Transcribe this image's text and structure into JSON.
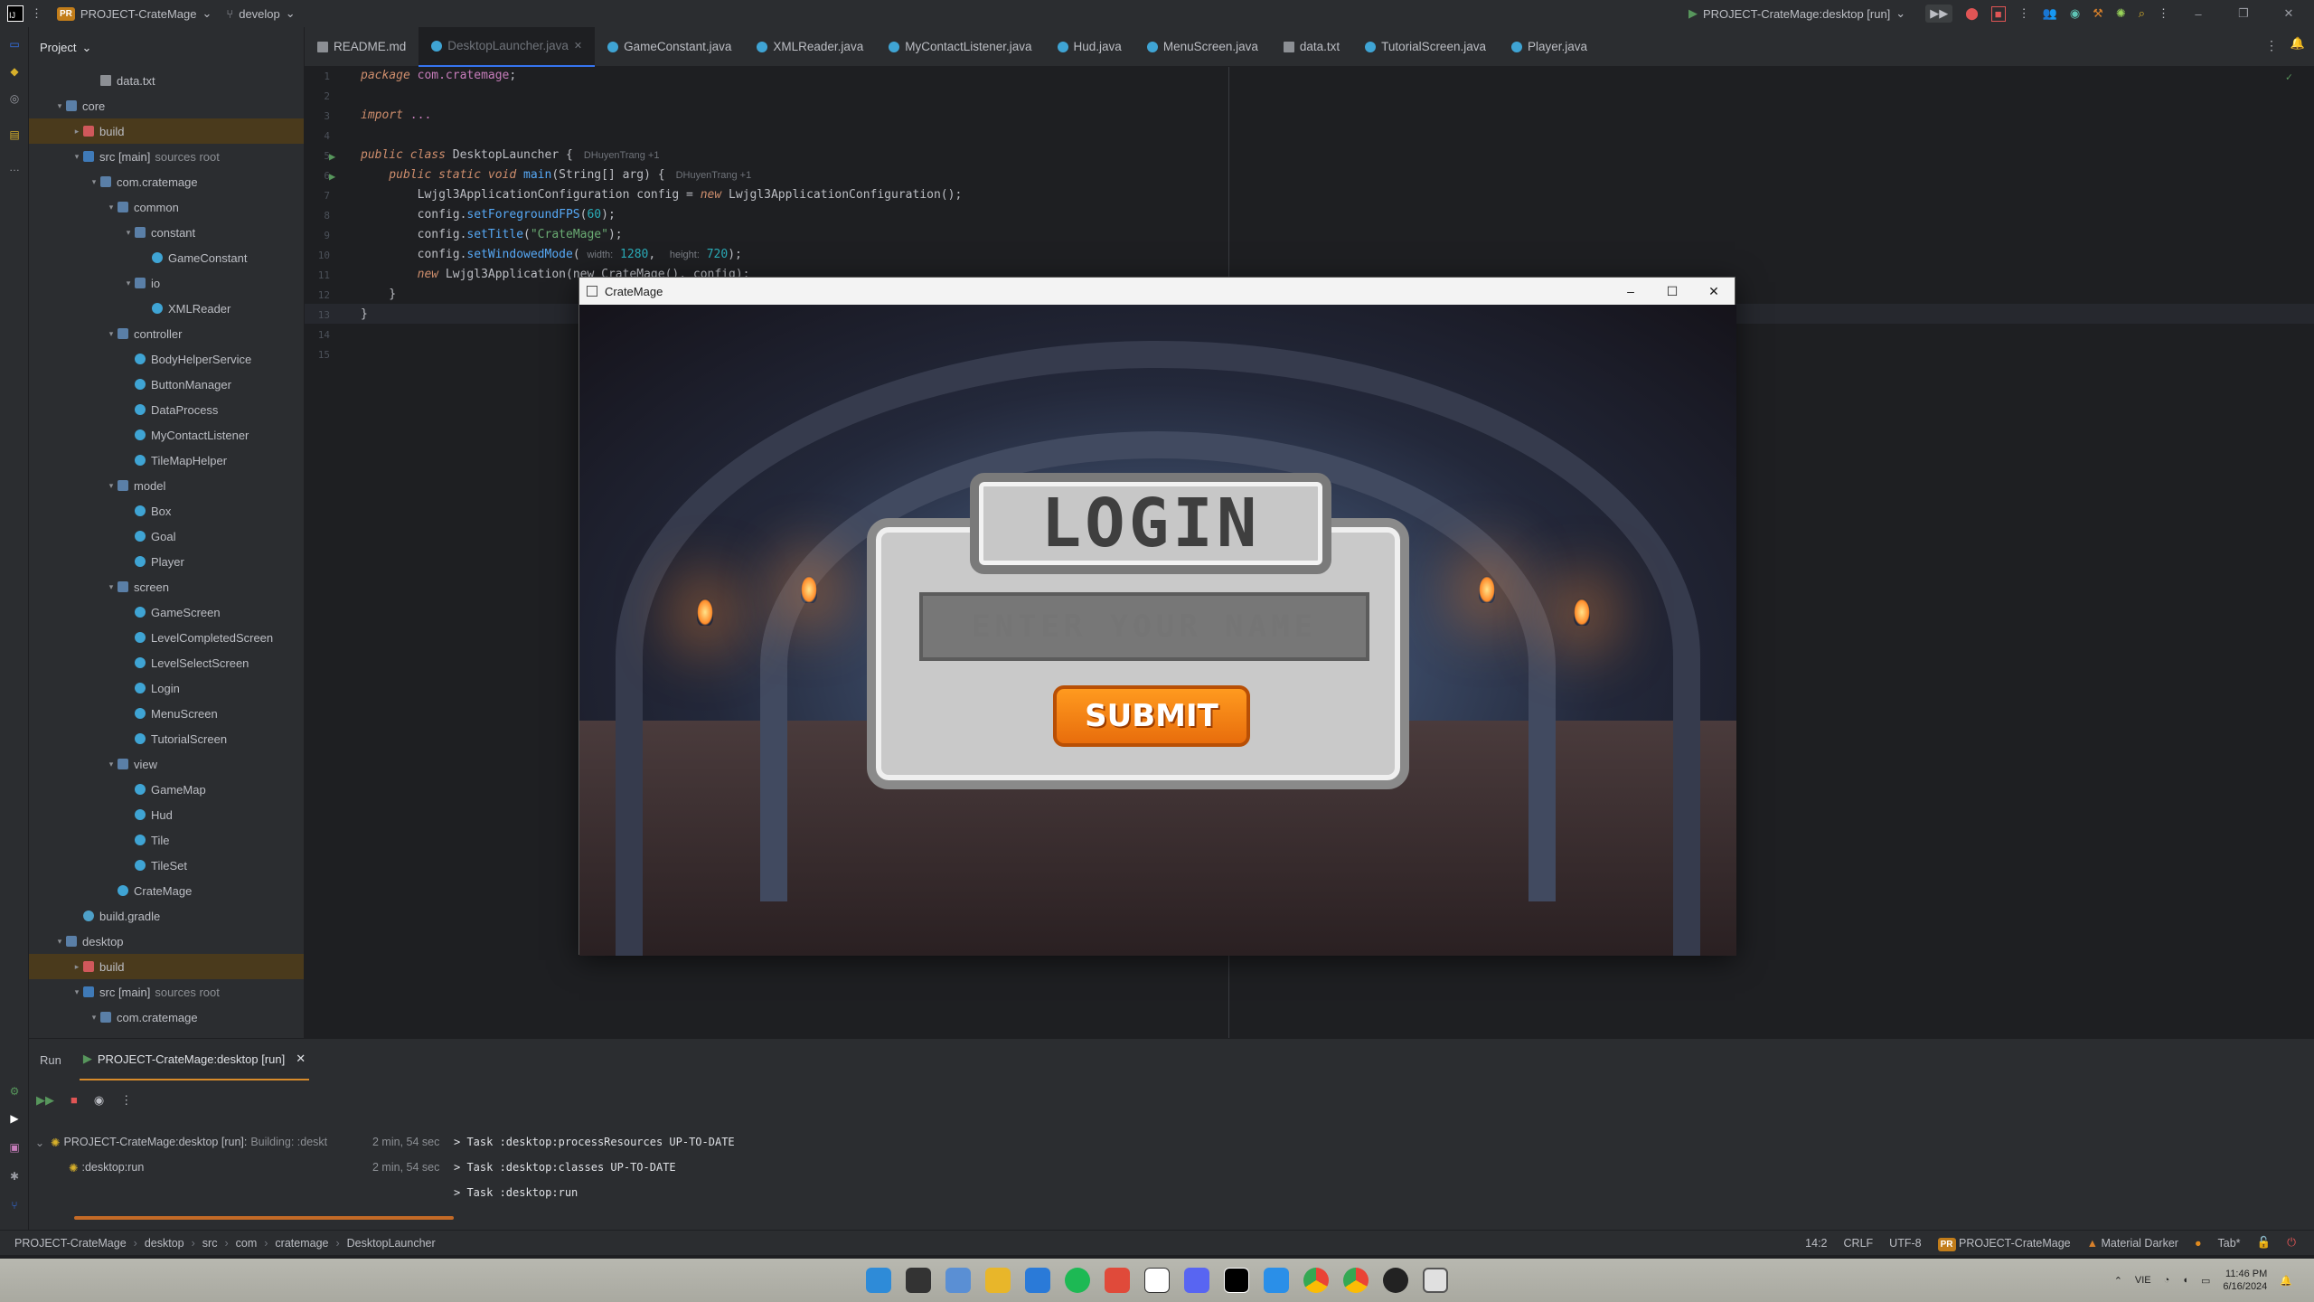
{
  "titlebar": {
    "project_badge": "PR",
    "project_name": "PROJECT-CrateMage",
    "branch": "develop",
    "run_config": "PROJECT-CrateMage:desktop [run]"
  },
  "project_panel": {
    "title": "Project",
    "rows": [
      {
        "label": "data.txt",
        "icon": "file",
        "indent": 3,
        "arrow": ""
      },
      {
        "label": "core",
        "icon": "folder",
        "indent": 1,
        "arrow": "v"
      },
      {
        "label": "build",
        "icon": "folder-red",
        "indent": 2,
        "arrow": ">",
        "selected": true
      },
      {
        "label": "src [main]",
        "suffix": "sources root",
        "icon": "folder-src",
        "indent": 2,
        "arrow": "v"
      },
      {
        "label": "com.cratemage",
        "icon": "pkg",
        "indent": 3,
        "arrow": "v"
      },
      {
        "label": "common",
        "icon": "pkg",
        "indent": 4,
        "arrow": "v"
      },
      {
        "label": "constant",
        "icon": "pkg",
        "indent": 5,
        "arrow": "v"
      },
      {
        "label": "GameConstant",
        "icon": "java",
        "indent": 6,
        "arrow": ""
      },
      {
        "label": "io",
        "icon": "pkg",
        "indent": 5,
        "arrow": "v"
      },
      {
        "label": "XMLReader",
        "icon": "java",
        "indent": 6,
        "arrow": ""
      },
      {
        "label": "controller",
        "icon": "pkg",
        "indent": 4,
        "arrow": "v"
      },
      {
        "label": "BodyHelperService",
        "icon": "java",
        "indent": 5,
        "arrow": ""
      },
      {
        "label": "ButtonManager",
        "icon": "java",
        "indent": 5,
        "arrow": ""
      },
      {
        "label": "DataProcess",
        "icon": "java",
        "indent": 5,
        "arrow": ""
      },
      {
        "label": "MyContactListener",
        "icon": "java",
        "indent": 5,
        "arrow": ""
      },
      {
        "label": "TileMapHelper",
        "icon": "java",
        "indent": 5,
        "arrow": ""
      },
      {
        "label": "model",
        "icon": "pkg",
        "indent": 4,
        "arrow": "v"
      },
      {
        "label": "Box",
        "icon": "java",
        "indent": 5,
        "arrow": ""
      },
      {
        "label": "Goal",
        "icon": "java",
        "indent": 5,
        "arrow": ""
      },
      {
        "label": "Player",
        "icon": "java",
        "indent": 5,
        "arrow": ""
      },
      {
        "label": "screen",
        "icon": "pkg",
        "indent": 4,
        "arrow": "v"
      },
      {
        "label": "GameScreen",
        "icon": "java",
        "indent": 5,
        "arrow": ""
      },
      {
        "label": "LevelCompletedScreen",
        "icon": "java",
        "indent": 5,
        "arrow": ""
      },
      {
        "label": "LevelSelectScreen",
        "icon": "java",
        "indent": 5,
        "arrow": ""
      },
      {
        "label": "Login",
        "icon": "java",
        "indent": 5,
        "arrow": ""
      },
      {
        "label": "MenuScreen",
        "icon": "java",
        "indent": 5,
        "arrow": ""
      },
      {
        "label": "TutorialScreen",
        "icon": "java",
        "indent": 5,
        "arrow": ""
      },
      {
        "label": "view",
        "icon": "pkg",
        "indent": 4,
        "arrow": "v"
      },
      {
        "label": "GameMap",
        "icon": "java",
        "indent": 5,
        "arrow": ""
      },
      {
        "label": "Hud",
        "icon": "java",
        "indent": 5,
        "arrow": ""
      },
      {
        "label": "Tile",
        "icon": "java",
        "indent": 5,
        "arrow": ""
      },
      {
        "label": "TileSet",
        "icon": "java",
        "indent": 5,
        "arrow": ""
      },
      {
        "label": "CrateMage",
        "icon": "java",
        "indent": 4,
        "arrow": ""
      },
      {
        "label": "build.gradle",
        "icon": "gradle",
        "indent": 2,
        "arrow": ""
      },
      {
        "label": "desktop",
        "icon": "folder",
        "indent": 1,
        "arrow": "v"
      },
      {
        "label": "build",
        "icon": "folder-red",
        "indent": 2,
        "arrow": ">",
        "selected": true
      },
      {
        "label": "src [main]",
        "suffix": "sources root",
        "icon": "folder-src",
        "indent": 2,
        "arrow": "v"
      },
      {
        "label": "com.cratemage",
        "icon": "pkg",
        "indent": 3,
        "arrow": "v"
      }
    ]
  },
  "editor_tabs": [
    {
      "label": "README.md",
      "icon": "file"
    },
    {
      "label": "DesktopLauncher.java",
      "icon": "java",
      "active": true
    },
    {
      "label": "GameConstant.java",
      "icon": "java"
    },
    {
      "label": "XMLReader.java",
      "icon": "java"
    },
    {
      "label": "MyContactListener.java",
      "icon": "java"
    },
    {
      "label": "Hud.java",
      "icon": "java"
    },
    {
      "label": "MenuScreen.java",
      "icon": "java"
    },
    {
      "label": "data.txt",
      "icon": "file"
    },
    {
      "label": "TutorialScreen.java",
      "icon": "java"
    },
    {
      "label": "Player.java",
      "icon": "java"
    }
  ],
  "editor": {
    "line_numbers": [
      "1",
      "2",
      "3",
      "4",
      "5",
      "6",
      "7",
      "8",
      "9",
      "10",
      "11",
      "12",
      "13",
      "14",
      "15"
    ],
    "author_hint": "DHuyenTrang +1",
    "code": {
      "l1_kw": "package",
      "l1_pkg": "com.cratemage",
      "l1_end": ";",
      "l3_kw": "import",
      "l3_rest": " ...",
      "l6_a": "public class",
      "l6_b": " DesktopLauncher {",
      "l7_a": "    public static void",
      "l7_b": " main",
      "l7_c": "(String[] arg) {",
      "l8_a": "        Lwjgl3ApplicationConfiguration config = ",
      "l8_b": "new",
      "l8_c": " Lwjgl3ApplicationConfiguration();",
      "l9_a": "        config.",
      "l9_b": "setForegroundFPS",
      "l9_c": "(",
      "l9_d": "60",
      "l9_e": ");",
      "l10_a": "        config.",
      "l10_b": "setTitle",
      "l10_c": "(",
      "l10_d": "\"CrateMage\"",
      "l10_e": ");",
      "l11_a": "        config.",
      "l11_b": "setWindowedMode",
      "l11_c": "( ",
      "l11_h1": "width:",
      "l11_d": " 1280",
      "l11_e": ",  ",
      "l11_h2": "height:",
      "l11_f": " 720",
      "l11_g": ");",
      "l12_a": "        ",
      "l12_b": "new",
      "l12_c": " Lwjgl3Application(new CrateMage(), config);",
      "l13": "    }",
      "l14": "}"
    }
  },
  "game_window": {
    "title": "CrateMage",
    "login_title": "LOGIN",
    "name_placeholder": "ENTER YOUR NAME",
    "submit_label": "SUBMIT"
  },
  "run_panel": {
    "tab_run": "Run",
    "tab_config": "PROJECT-CrateMage:desktop [run]",
    "tree": [
      {
        "label": "PROJECT-CrateMage:desktop [run]:",
        "detail": "Building: :deskt",
        "time": "2 min, 54 sec"
      },
      {
        "label": ":desktop:run",
        "detail": "",
        "time": "2 min, 54 sec"
      }
    ],
    "console": [
      "> Task :desktop:processResources UP-TO-DATE",
      "> Task :desktop:classes UP-TO-DATE",
      "> Task :desktop:run"
    ]
  },
  "statusbar": {
    "crumbs": [
      "PROJECT-CrateMage",
      "desktop",
      "src",
      "com",
      "cratemage",
      "DesktopLauncher"
    ],
    "position": "14:2",
    "line_sep": "CRLF",
    "encoding": "UTF-8",
    "project": "PROJECT-CrateMage",
    "theme": "Material Darker",
    "indent": "Tab*"
  },
  "taskbar": {
    "lang": "VIE",
    "time": "11:46 PM",
    "date": "6/16/2024"
  },
  "colors": {
    "accent": "#3574f0",
    "run_orange": "#d78b2b",
    "selected_folder": "#4a3a1c"
  }
}
